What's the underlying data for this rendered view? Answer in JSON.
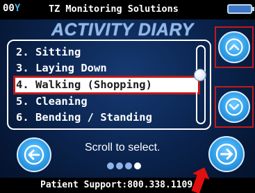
{
  "status": {
    "signal": "00",
    "antenna_icon": "Y",
    "brand": "TZ Monitoring Solutions",
    "battery_icon": "battery-icon"
  },
  "title": "ACTIVITY DIARY",
  "list": {
    "items": [
      {
        "label": "2. Sitting"
      },
      {
        "label": "3. Laying Down"
      },
      {
        "label": "4. Walking (Shopping)"
      },
      {
        "label": "5. Cleaning"
      },
      {
        "label": "6. Bending / Standing"
      }
    ],
    "selected_index": 2,
    "scroll_position": 0.35
  },
  "hint": "Scroll to select.",
  "pager": {
    "pages": 4,
    "current": 4
  },
  "footer": "Patient Support:800.338.1109",
  "colors": {
    "background": "#0b2550",
    "title": "#8fb8ea",
    "button": "#2f9ee8",
    "highlight_border": "#c01818",
    "annotation_arrow": "#e01010"
  },
  "icons": {
    "scroll_up": "chevron-up-icon",
    "scroll_down": "chevron-down-icon",
    "back": "arrow-left-icon",
    "next": "arrow-right-icon"
  }
}
